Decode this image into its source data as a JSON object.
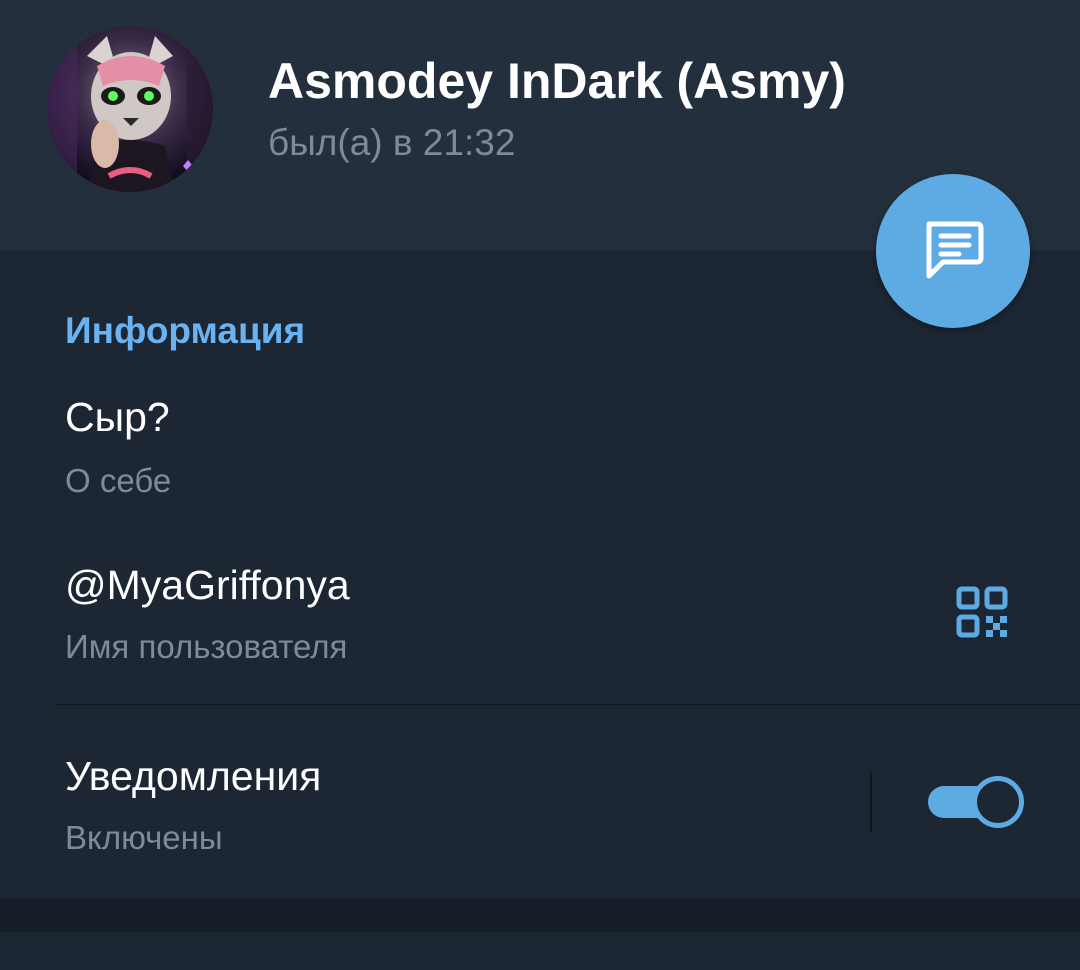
{
  "profile": {
    "name": "Asmodey InDark (Asmy)",
    "status": "был(а) в 21:32",
    "avatar_icon": "user-avatar-photo"
  },
  "fab": {
    "icon": "message-bubble-icon"
  },
  "info": {
    "section_title": "Информация",
    "bio": {
      "value": "Сыр?",
      "label": "О себе"
    },
    "username": {
      "value": "@MyaGriffonya",
      "label": "Имя пользователя",
      "icon": "qr-code-icon"
    },
    "notifications": {
      "value": "Уведомления",
      "label": "Включены",
      "enabled": true
    }
  },
  "colors": {
    "accent": "#5eabe3",
    "section_title": "#6ab3f3",
    "background": "#1d2733",
    "header_background": "#242f3d",
    "secondary_text": "#7d8b99"
  }
}
